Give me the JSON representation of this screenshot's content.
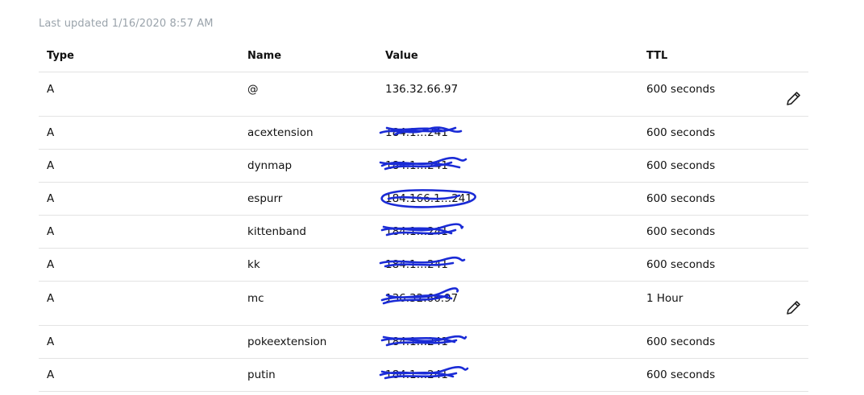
{
  "last_updated": "Last updated 1/16/2020 8:57 AM",
  "headers": {
    "type": "Type",
    "name": "Name",
    "value": "Value",
    "ttl": "TTL"
  },
  "rows": [
    {
      "type": "A",
      "name": "@",
      "value": "136.32.66.97",
      "ttl": "600 seconds",
      "editable": true,
      "redacted": false
    },
    {
      "type": "A",
      "name": "acextension",
      "value": "184.1…241",
      "ttl": "600 seconds",
      "editable": false,
      "redacted": true
    },
    {
      "type": "A",
      "name": "dynmap",
      "value": "184.1…241",
      "ttl": "600 seconds",
      "editable": false,
      "redacted": true
    },
    {
      "type": "A",
      "name": "espurr",
      "value": "184.166.1…241",
      "ttl": "600 seconds",
      "editable": false,
      "redacted": true
    },
    {
      "type": "A",
      "name": "kittenband",
      "value": "184.1…241",
      "ttl": "600 seconds",
      "editable": false,
      "redacted": true
    },
    {
      "type": "A",
      "name": "kk",
      "value": "184.1…241",
      "ttl": "600 seconds",
      "editable": false,
      "redacted": true
    },
    {
      "type": "A",
      "name": "mc",
      "value": "136.32.66.97",
      "ttl": "1 Hour",
      "editable": true,
      "redacted": true
    },
    {
      "type": "A",
      "name": "pokeextension",
      "value": "184.1…241",
      "ttl": "600 seconds",
      "editable": false,
      "redacted": true
    },
    {
      "type": "A",
      "name": "putin",
      "value": "184.1…241",
      "ttl": "600 seconds",
      "editable": false,
      "redacted": true
    }
  ],
  "colors": {
    "scribble": "#1a2bd6",
    "muted_text": "#9aa3ab",
    "divider": "#e3e3e3"
  },
  "icons": {
    "edit": "pencil-icon"
  }
}
